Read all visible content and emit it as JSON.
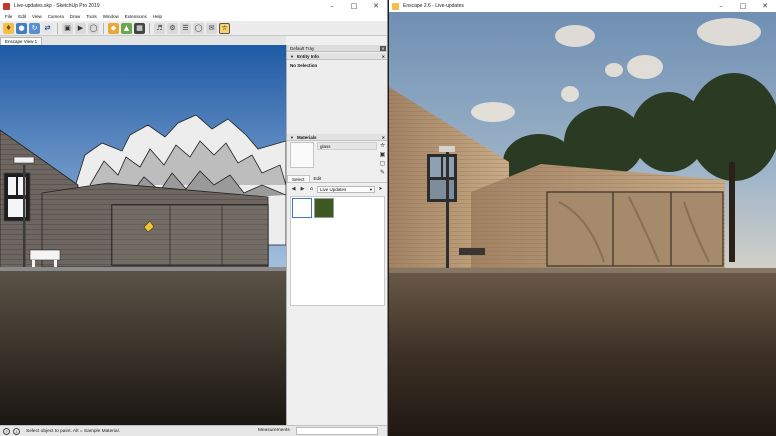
{
  "sketchup": {
    "title": "Live-updates.skp - SketchUp Pro 2019",
    "menu": [
      "File",
      "Edit",
      "View",
      "Camera",
      "Draw",
      "Tools",
      "Window",
      "Extensions",
      "Help"
    ],
    "scene_tab": "Enscape View 1",
    "tray": {
      "title": "Default Tray",
      "entity_info": {
        "header": "Entity Info",
        "selection": "No Selection"
      },
      "materials": {
        "header": "Materials",
        "current_material": "glass",
        "tabs": [
          "Select",
          "Edit"
        ],
        "library": "Live Updates"
      }
    },
    "status": {
      "hint": "Select object to paint. Alt = Sample Material.",
      "measurements_label": "Measurements",
      "measurements_value": ""
    }
  },
  "enscape": {
    "title": "Enscape 2.6 - Live-updates"
  },
  "colors": {
    "sky_top": "#1f5aa6",
    "sky_bottom": "#a8c3e0",
    "tree_highlight": "#f4f4f4",
    "grass_swatch": "#3e5a22",
    "enscape_sky": "#7f9bb8"
  }
}
